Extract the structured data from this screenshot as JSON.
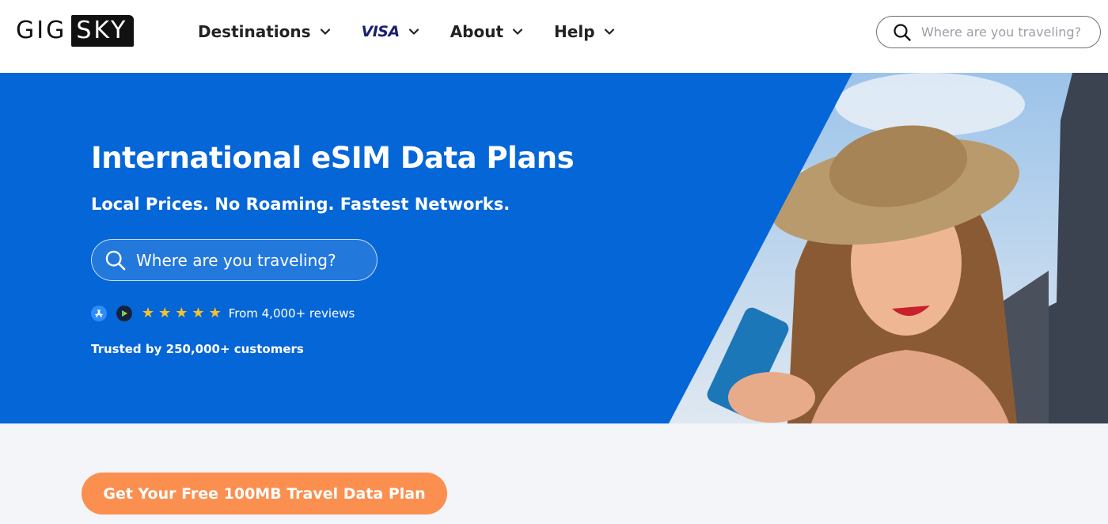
{
  "brand": {
    "logo_left": "GIG",
    "logo_right": "SKY"
  },
  "nav": {
    "items": [
      {
        "label": "Destinations"
      },
      {
        "label": "VISA"
      },
      {
        "label": "About"
      },
      {
        "label": "Help"
      }
    ]
  },
  "header_search": {
    "placeholder": "Where are you traveling?"
  },
  "hero": {
    "title": "International eSIM Data Plans",
    "subtitle": "Local Prices. No Roaming. Fastest Networks.",
    "search_placeholder": "Where are you traveling?",
    "rating_stars": 5,
    "reviews_text": "From 4,000+ reviews",
    "trusted_text": "Trusted by 250,000+ customers"
  },
  "cta": {
    "label": "Get Your Free 100MB Travel Data Plan"
  },
  "colors": {
    "hero_blue": "#0566d8",
    "cta_orange": "#fb8f50",
    "star_yellow": "#f7c325",
    "visa_blue": "#1a1f71"
  },
  "icons": [
    "search-icon",
    "chevron-down-icon",
    "app-store-icon",
    "google-play-icon",
    "star-icon"
  ]
}
